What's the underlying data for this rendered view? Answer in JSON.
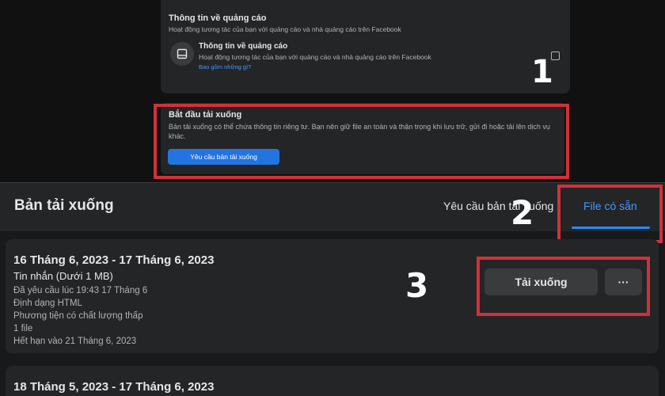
{
  "top": {
    "ad_section": {
      "title": "Thông tin về quảng cáo",
      "subtitle": "Hoạt động tương tác của bạn với quảng cáo và nhà quảng cáo trên Facebook",
      "row_title": "Thông tin về quảng cáo",
      "row_subtitle": "Hoạt động tương tác của bạn với quảng cáo và nhà quảng cáo trên Facebook",
      "row_link": "Bao gồm những gì?",
      "row_icon": "document-icon",
      "checked": false
    },
    "download_section": {
      "title": "Bắt đầu tải xuống",
      "description": "Bản tải xuống có thể chứa thông tin riêng tư. Bạn nên giữ file an toàn và thận trọng khi lưu trữ, gửi đi hoặc tải lên dịch vụ khác.",
      "button": "Yêu cầu bản tải xuống"
    },
    "step_number": "1"
  },
  "bottom": {
    "header_title": "Bản tải xuống",
    "tabs": [
      {
        "label": "Yêu cầu bản tải xuống",
        "active": false
      },
      {
        "label": "File có sẵn",
        "active": true
      }
    ],
    "step_number_tabs": "2",
    "step_number_download": "3",
    "items": [
      {
        "date_range": "16 Tháng 6, 2023 - 17 Tháng 6, 2023",
        "type": "Tin nhắn (Dưới 1 MB)",
        "meta": [
          "Đã yêu cầu lúc 19:43 17 Tháng 6",
          "Định dạng HTML",
          "Phương tiện có chất lượng thấp",
          "1 file",
          "Hết hạn vào 21 Tháng 6, 2023"
        ],
        "download_label": "Tải xuống",
        "more_label": "···"
      },
      {
        "date_range": "18 Tháng 5, 2023 - 17 Tháng 6, 2023"
      }
    ]
  },
  "colors": {
    "accent": "#2d88ff",
    "link": "#4599ff",
    "highlight_box": "#d0313a",
    "card": "#242526",
    "background": "#18191a"
  }
}
